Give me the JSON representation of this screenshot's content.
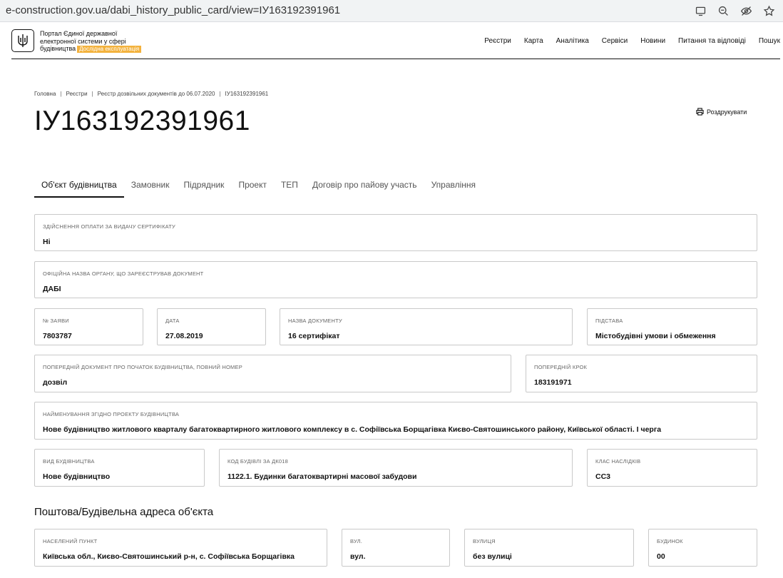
{
  "browser": {
    "url": "e-construction.gov.ua/dabi_history_public_card/view=ІУ163192391961"
  },
  "header": {
    "portal_line1": "Портал Єдиної державної",
    "portal_line2": "електронної системи у сфері",
    "portal_line3": "будівництва",
    "beta_badge": "Дослідна експлуатація",
    "nav": [
      "Реєстри",
      "Карта",
      "Аналітика",
      "Сервіси",
      "Новини",
      "Питання та відповіді",
      "Пошук"
    ]
  },
  "breadcrumb": [
    "Головна",
    "Реєстри",
    "Реєстр дозвільних документів до 06.07.2020",
    "ІУ163192391961"
  ],
  "title": "ІУ163192391961",
  "print_label": "Роздрукувати",
  "tabs": [
    "Об'єкт будівництва",
    "Замовник",
    "Підрядник",
    "Проект",
    "ТЕП",
    "Договір про пайову участь",
    "Управління"
  ],
  "fields": {
    "payment": {
      "label": "Здійснення оплати за видачу сертифікату",
      "value": "Ні"
    },
    "authority": {
      "label": "Офіційна назва органу, що зареєстрував документ",
      "value": "ДАБІ"
    },
    "application_no": {
      "label": "№ заяви",
      "value": "7803787"
    },
    "date": {
      "label": "Дата",
      "value": "27.08.2019"
    },
    "doc_name": {
      "label": "Назва документу",
      "value": "16 сертифікат"
    },
    "basis": {
      "label": "Підстава",
      "value": "Містобудівні умови і обмеження"
    },
    "prev_doc": {
      "label": "Попередній документ про початок будівництва, повний номер",
      "value": "дозвіл"
    },
    "prev_step": {
      "label": "Попередній крок",
      "value": "183191971"
    },
    "project_name": {
      "label": "Найменування згідно проекту будівництва",
      "value": "Нове будівництво житлового кварталу багатоквартирного житлового комплексу в с. Софіївська Борщагівка Києво-Святошинського району, Київської області. І черга"
    },
    "construction_type": {
      "label": "Вид будівництва",
      "value": "Нове будівництво"
    },
    "building_code": {
      "label": "Код будівлі за ДК018",
      "value": "1122.1. Будинки багатоквартирні масової забудови"
    },
    "consequence_class": {
      "label": "Клас наслідків",
      "value": "СС3"
    }
  },
  "address_heading": "Поштова/Будівельна адреса об'єкта",
  "address": {
    "locality": {
      "label": "Населений пункт",
      "value": "Київська обл., Києво-Святошинський р-н, с. Софіївська Борщагівка"
    },
    "street_type": {
      "label": "Вул.",
      "value": "вул."
    },
    "street": {
      "label": "Вулиця",
      "value": "без вулиці"
    },
    "building": {
      "label": "Будинок",
      "value": "00"
    }
  }
}
